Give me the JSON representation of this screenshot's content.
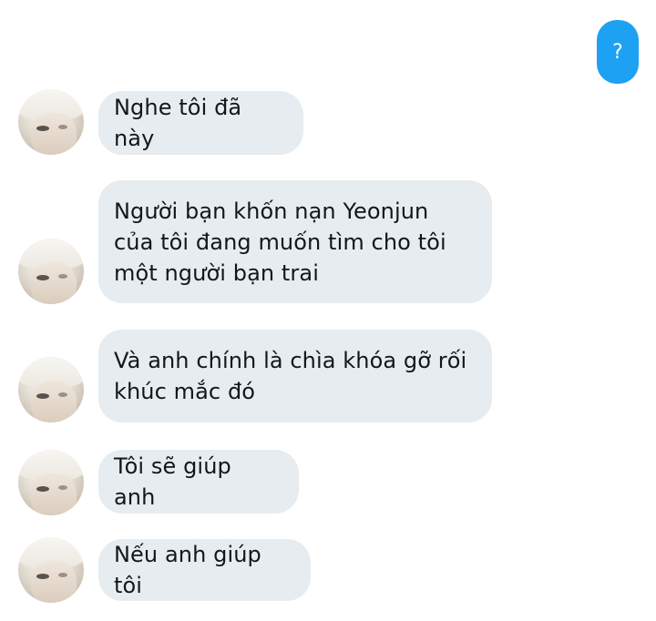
{
  "sent": {
    "text": "?"
  },
  "messages": [
    {
      "text": "Nghe tôi đã này"
    },
    {
      "text": "Người bạn khốn nạn Yeonjun\ncủa tôi đang muốn tìm cho tôi\nmột người bạn trai"
    },
    {
      "text": "Và anh chính là chìa khóa gỡ rối\nkhúc mắc đó"
    },
    {
      "text": "Tôi sẽ giúp anh"
    },
    {
      "text": "Nếu anh giúp tôi"
    }
  ],
  "colors": {
    "sent_bubble": "#1da1f2",
    "received_bubble": "#e6ecf0",
    "text": "#14171a"
  }
}
